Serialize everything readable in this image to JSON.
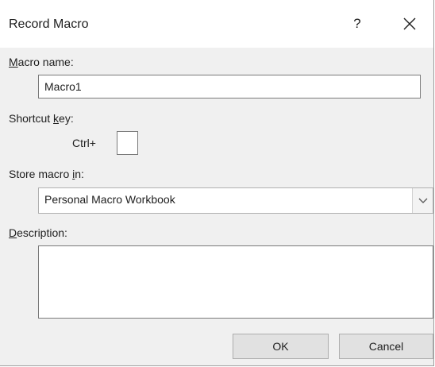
{
  "window": {
    "title": "Record Macro",
    "help_glyph": "?",
    "close_icon": "close-icon"
  },
  "macro_name": {
    "label_mnemonic": "M",
    "label_rest": "acro name:",
    "value": "Macro1"
  },
  "shortcut": {
    "label_pre": "Shortcut ",
    "label_mnemonic": "k",
    "label_post": "ey:",
    "prefix": "Ctrl+",
    "value": ""
  },
  "store": {
    "label_pre": "Store macro ",
    "label_mnemonic": "i",
    "label_post": "n:",
    "selected": "Personal Macro Workbook",
    "dropdown_icon": "chevron-down-icon"
  },
  "description": {
    "label_mnemonic": "D",
    "label_rest": "escription:",
    "value": ""
  },
  "buttons": {
    "ok_label": "OK",
    "cancel_label": "Cancel"
  },
  "colors": {
    "dialog_bg": "#f0f0f0",
    "titlebar_bg": "#ffffff",
    "field_border": "#7a7a7a",
    "button_bg": "#e1e1e1",
    "button_border": "#adadad"
  }
}
